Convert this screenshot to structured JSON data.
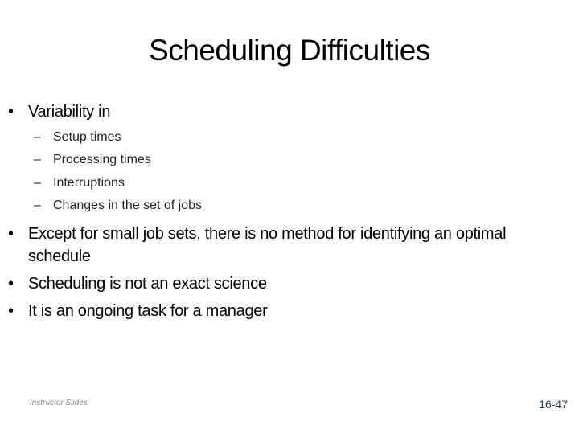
{
  "slide": {
    "title": "Scheduling Difficulties",
    "bullets": [
      {
        "text": "Variability in",
        "subitems": [
          "Setup times",
          "Processing times",
          "Interruptions",
          "Changes in the set of jobs"
        ]
      },
      {
        "text": "Except for small job sets, there is no method for identifying an optimal schedule"
      },
      {
        "text": "Scheduling is not an exact science"
      },
      {
        "text": "It is an ongoing task for a manager"
      }
    ],
    "bullet_glyph": "•",
    "dash_glyph": "–",
    "footer": {
      "label": "Instructor Slides",
      "page_number": "16-47"
    }
  }
}
